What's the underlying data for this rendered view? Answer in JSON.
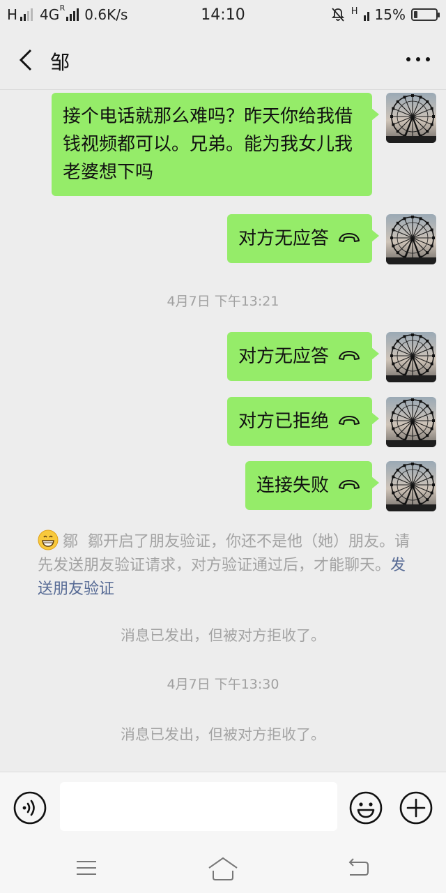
{
  "status_bar": {
    "network_h": "H",
    "network_4g": "4G",
    "network_4g_sup": "R",
    "speed": "0.6K/s",
    "time": "14:10",
    "signal_label": "H",
    "battery": "15%",
    "battery_level": 0.15
  },
  "header": {
    "title": "邹"
  },
  "messages": [
    {
      "type": "text",
      "text": "接个电话就那么难吗？昨天你给我借钱视频都可以。兄弟。能为我女儿我老婆想下吗"
    },
    {
      "type": "call",
      "text": "对方无应答"
    },
    {
      "type": "timestamp",
      "text": "4月7日 下午13:21"
    },
    {
      "type": "call",
      "text": "对方无应答"
    },
    {
      "type": "call",
      "text": "对方已拒绝"
    },
    {
      "type": "call",
      "text": "连接失败"
    }
  ],
  "verify_notice": {
    "name": "鄒",
    "text": "鄒开启了朋友验证，你还不是他（她）朋友。请先发送朋友验证请求，对方验证通过后，才能聊天。",
    "link": "发送朋友验证"
  },
  "system_messages": [
    "消息已发出，但被对方拒收了。",
    "4月7日 下午13:30",
    "消息已发出，但被对方拒收了。"
  ],
  "input": {
    "value": ""
  },
  "colors": {
    "bubble": "#95ec69",
    "background": "#ededed",
    "link": "#576b95"
  },
  "icons": [
    "back-arrow-icon",
    "more-dots-icon",
    "voice-icon",
    "emoji-icon",
    "plus-icon",
    "menu-icon",
    "home-icon",
    "back-icon",
    "phone-hangup-icon",
    "mute-bell-icon",
    "battery-icon"
  ]
}
